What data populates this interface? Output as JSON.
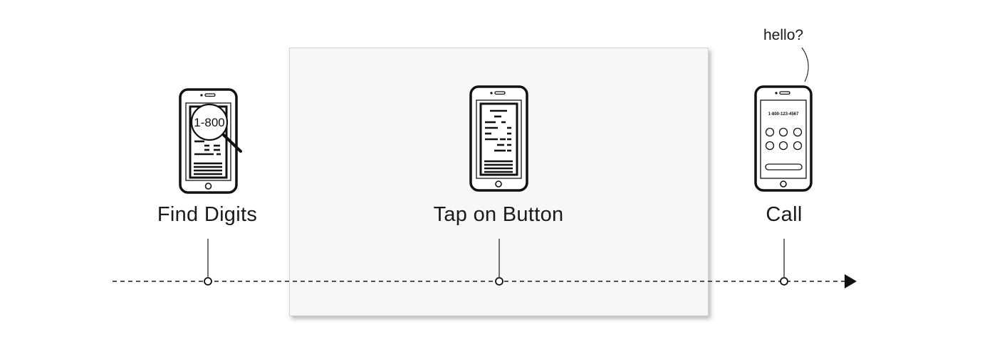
{
  "steps": [
    {
      "label": "Find Digits",
      "phone_text": "1-800"
    },
    {
      "label": "Tap on Button"
    },
    {
      "label": "Call",
      "phone_text": "1-800-123-4567",
      "speech": "hello?"
    }
  ]
}
